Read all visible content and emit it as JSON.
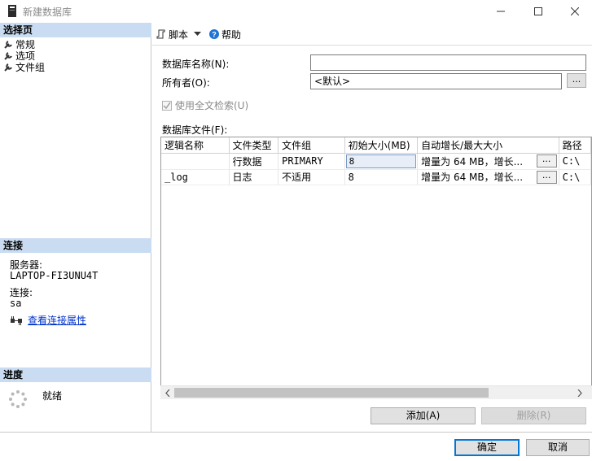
{
  "window": {
    "title": "新建数据库"
  },
  "left": {
    "select_page_header": "选择页",
    "pages": [
      {
        "label": "常规"
      },
      {
        "label": "选项"
      },
      {
        "label": "文件组"
      }
    ],
    "connection_header": "连接",
    "server_label": "服务器:",
    "server_value": "LAPTOP-FI3UNU4T",
    "conn_label": "连接:",
    "conn_value": "sa",
    "view_conn_props": "查看连接属性",
    "progress_header": "进度",
    "progress_status": "就绪"
  },
  "toolbar": {
    "script_label": "脚本",
    "help_label": "帮助"
  },
  "form": {
    "db_name_label": "数据库名称(N):",
    "db_name_value": "",
    "owner_label": "所有者(O):",
    "owner_value": "<默认>",
    "browse_label": "...",
    "fulltext_label": "使用全文检索(U)",
    "files_label": "数据库文件(F):"
  },
  "files_grid": {
    "columns": [
      "逻辑名称",
      "文件类型",
      "文件组",
      "初始大小(MB)",
      "自动增长/最大大小",
      "路径"
    ],
    "rows": [
      {
        "logical_name": "",
        "file_type": "行数据",
        "filegroup": "PRIMARY",
        "initial_size": "8",
        "autogrowth": "增量为 64 MB，增长...",
        "path": "C:\\"
      },
      {
        "logical_name": "_log",
        "file_type": "日志",
        "filegroup": "不适用",
        "initial_size": "8",
        "autogrowth": "增量为 64 MB，增长...",
        "path": "C:\\"
      }
    ],
    "ellipsis": "..."
  },
  "buttons": {
    "add": "添加(A)",
    "remove": "删除(R)",
    "ok": "确定",
    "cancel": "取消"
  },
  "colors": {
    "section_header_bg": "#c9dcf1",
    "link": "#0033cc",
    "help_icon": "#1e74d6",
    "default_button_border": "#0078d7"
  },
  "icons": {
    "app": "database-icon",
    "page": "wrench-icon",
    "script": "script-icon",
    "help": "help-circle-icon",
    "connection": "connection-plug-icon",
    "progress": "spinner-icon"
  }
}
